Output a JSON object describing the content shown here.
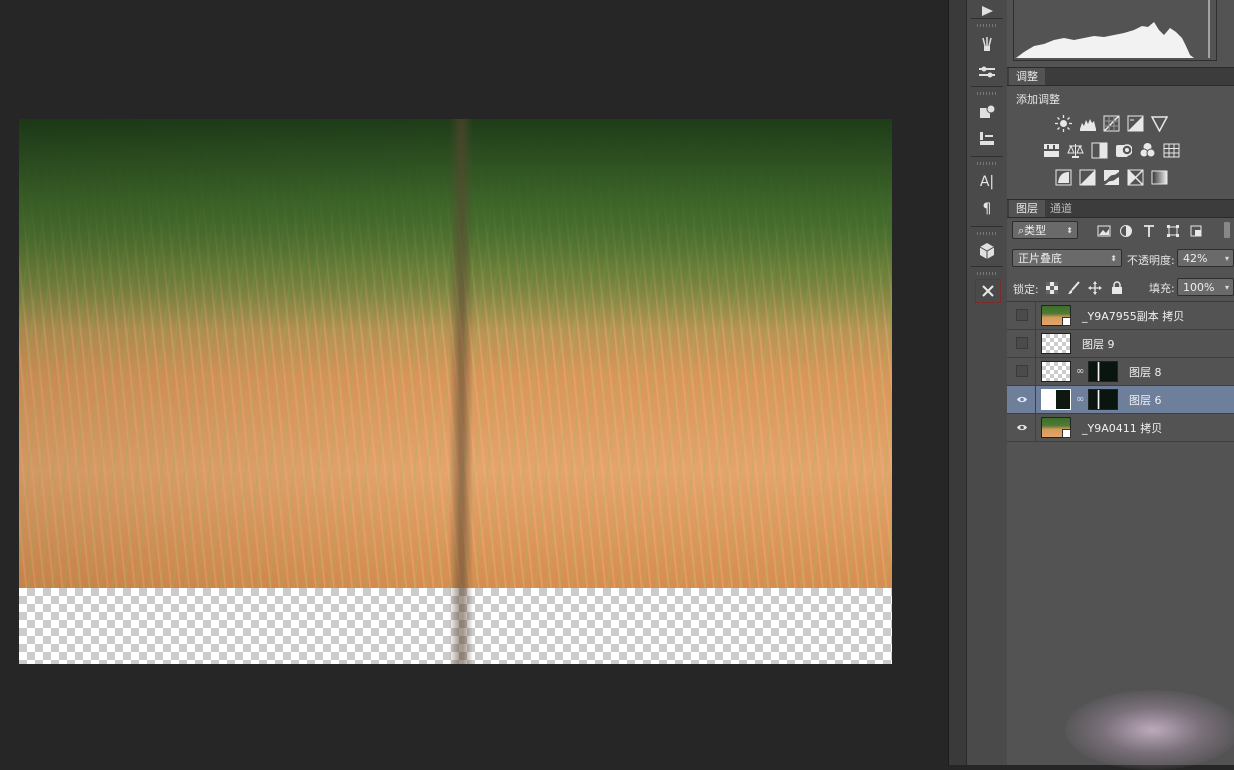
{
  "adjustments_panel": {
    "tab_label": "调整",
    "title": "添加调整",
    "icon_rows": [
      [
        "brightness-contrast-icon",
        "levels-icon",
        "curves-icon",
        "exposure-icon",
        "vibrance-icon"
      ],
      [
        "hue-saturation-icon",
        "color-balance-icon",
        "black-white-icon",
        "photo-filter-icon",
        "channel-mixer-icon",
        "color-lookup-icon"
      ],
      [
        "invert-icon",
        "posterize-icon",
        "threshold-icon",
        "selective-color-icon",
        "gradient-map-icon"
      ]
    ]
  },
  "layers_panel": {
    "tabs": [
      "图层",
      "通道"
    ],
    "filter_kind": "类型",
    "blend_mode": "正片叠底",
    "opacity_label": "不透明度:",
    "opacity_value": "42%",
    "lock_label": "锁定:",
    "fill_label": "填充:",
    "fill_value": "100%",
    "layers": [
      {
        "name": "_Y9A7955副本 拷贝",
        "visible": false,
        "selected": false
      },
      {
        "name": "图层 9",
        "visible": false,
        "selected": false
      },
      {
        "name": "图层 8",
        "visible": false,
        "selected": false
      },
      {
        "name": "图层 6",
        "visible": true,
        "selected": true
      },
      {
        "name": "_Y9A0411 拷贝",
        "visible": true,
        "selected": false
      }
    ]
  },
  "toolbar": {
    "tools": [
      "play-icon",
      "brush-presets-icon",
      "tool-presets-icon",
      "clone-source-icon",
      "stamp-icon",
      "character-icon",
      "paragraph-icon",
      "3d-icon",
      "close-panel-icon"
    ],
    "character_glyph": "A|",
    "paragraph_glyph": "¶"
  }
}
